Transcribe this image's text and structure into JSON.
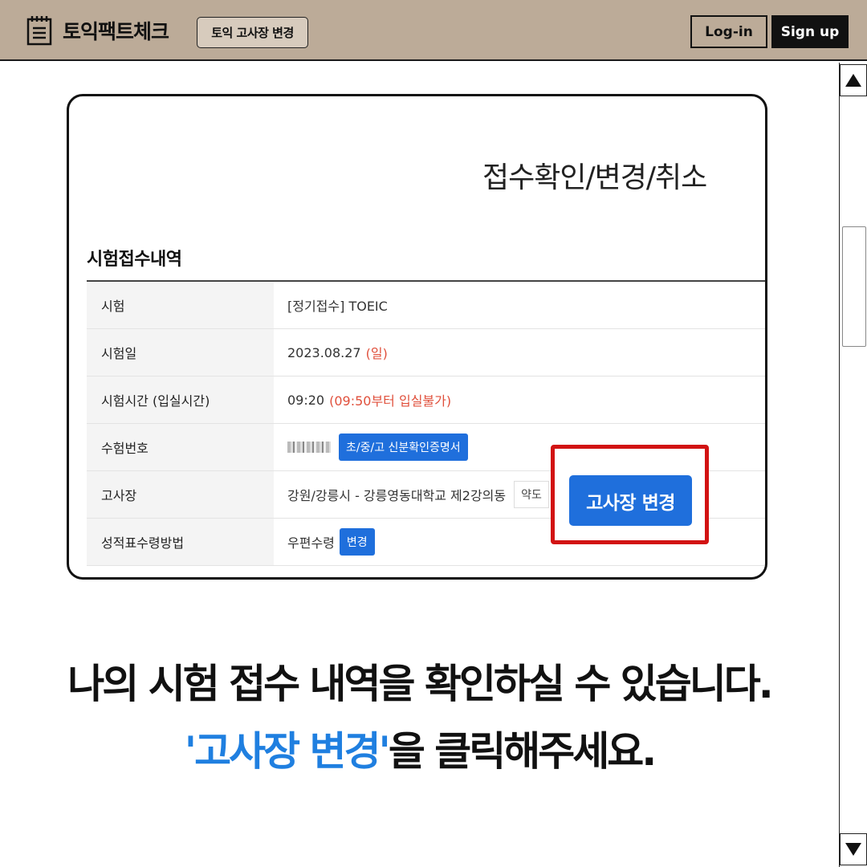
{
  "header": {
    "logo_text": "토익팩트체크",
    "chip_label": "토익 고사장 변경",
    "login_label": "Log-in",
    "signup_label": "Sign up"
  },
  "card": {
    "title": "접수확인/변경/취소",
    "section_title": "시험접수내역",
    "rows": [
      {
        "label": "시험",
        "value": "[정기접수] TOEIC"
      },
      {
        "label": "시험일",
        "value": "2023.08.27",
        "extra": "(일)"
      },
      {
        "label": "시험시간 (입실시간)",
        "value": "09:20",
        "extra": "(09:50부터 입실불가)"
      },
      {
        "label": "수험번호",
        "button": "초/중/고 신분확인증명서"
      },
      {
        "label": "고사장",
        "value": "강원/강릉시 - 강릉영동대학교 제2강의동",
        "extra": "약도"
      },
      {
        "label": "성적표수령방법",
        "value": "우편수령",
        "button": "변경"
      }
    ],
    "highlight_button": "고사장 변경"
  },
  "caption": {
    "line1": "나의 시험 접수 내역을 확인하실 수 있습니다.",
    "line2_accent": "'고사장 변경'",
    "line2_rest": "을 클릭해주세요."
  },
  "colors": {
    "header_bg": "#bcab98",
    "accent_blue": "#1f6fdc",
    "highlight_red": "#d21313",
    "text_red": "#e0503c"
  }
}
